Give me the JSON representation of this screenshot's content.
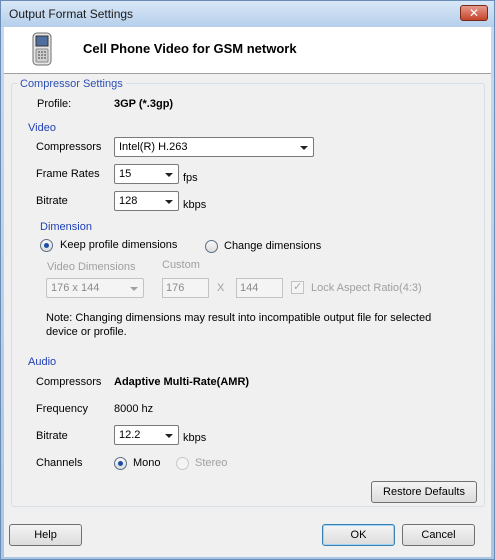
{
  "window": {
    "title": "Output Format Settings",
    "close_icon": "close-icon"
  },
  "header": {
    "icon": "cell-phone-icon",
    "title": "Cell Phone Video for GSM network"
  },
  "compressor": {
    "legend": "Compressor Settings",
    "profile_label": "Profile:",
    "profile_value": "3GP (*.3gp)"
  },
  "video": {
    "section": "Video",
    "compressors_label": "Compressors",
    "compressors_value": "Intel(R) H.263",
    "frame_rates_label": "Frame Rates",
    "frame_rates_value": "15",
    "frame_rates_unit": "fps",
    "bitrate_label": "Bitrate",
    "bitrate_value": "128",
    "bitrate_unit": "kbps"
  },
  "dimension": {
    "section": "Dimension",
    "keep_label": "Keep profile dimensions",
    "change_label": "Change dimensions",
    "video_dimensions_label": "Video Dimensions",
    "video_dimensions_value": "176 x 144",
    "custom_label": "Custom",
    "custom_width": "176",
    "x_label": "X",
    "custom_height": "144",
    "lock_aspect_label": "Lock Aspect Ratio(4:3)",
    "note_line1": "Note: Changing dimensions may result into incompatible output file for selected",
    "note_line2": "device or profile."
  },
  "audio": {
    "section": "Audio",
    "compressors_label": "Compressors",
    "compressors_value": "Adaptive Multi-Rate(AMR)",
    "frequency_label": "Frequency",
    "frequency_value": "8000  hz",
    "bitrate_label": "Bitrate",
    "bitrate_value": "12.2",
    "bitrate_unit": "kbps",
    "channels_label": "Channels",
    "mono_label": "Mono",
    "stereo_label": "Stereo"
  },
  "buttons": {
    "restore_defaults": "Restore Defaults",
    "help": "Help",
    "ok": "OK",
    "cancel": "Cancel"
  },
  "colors": {
    "section_blue": "#1f3fb5",
    "title_bar": "#b6cfeb"
  }
}
